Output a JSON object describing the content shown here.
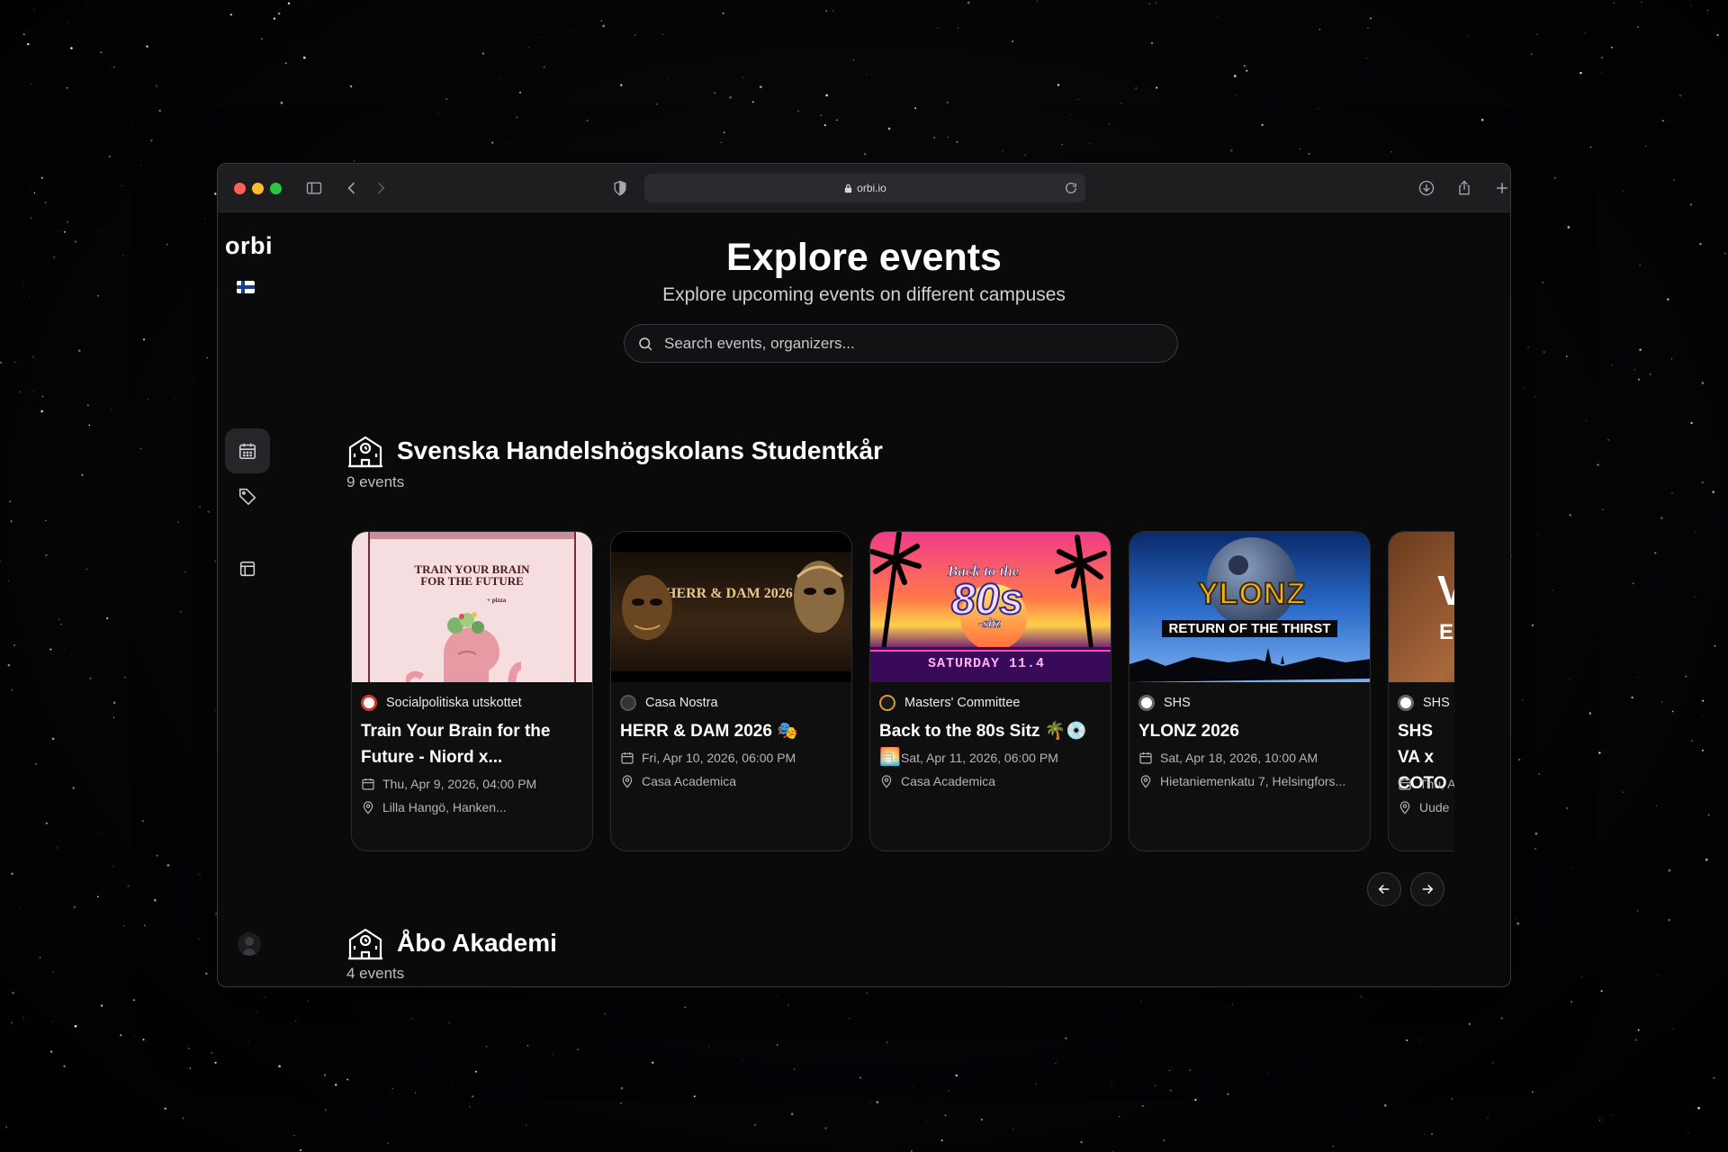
{
  "browser": {
    "url": "orbi.io"
  },
  "app": {
    "logo": "orbi"
  },
  "hero": {
    "title": "Explore events",
    "subtitle": "Explore upcoming events on different campuses"
  },
  "search": {
    "placeholder": "Search events, organizers..."
  },
  "sections": [
    {
      "title": "Svenska Handelshögskolans Studentkår",
      "count": "9 events",
      "events": [
        {
          "organizer": "Socialpolitiska utskottet",
          "title": "Train Your Brain for the Future - Niord x...",
          "date": "Thu, Apr 9, 2026, 04:00 PM",
          "location": "Lilla Hangö, Hanken...",
          "image_text": [
            "TRAIN YOUR BRAIN",
            "FOR THE FUTURE",
            "+ pizza"
          ]
        },
        {
          "organizer": "Casa Nostra",
          "title": "HERR & DAM 2026 🎭",
          "date": "Fri, Apr 10, 2026, 06:00 PM",
          "location": "Casa Academica",
          "image_text": [
            "HERR & DAM 2026"
          ]
        },
        {
          "organizer": "Masters' Committee",
          "title": "Back to the 80s Sitz 🌴💿🌅",
          "date": "Sat, Apr 11, 2026, 06:00 PM",
          "location": "Casa Academica",
          "image_text": [
            "Back to the",
            "80s",
            "-sitz",
            "SATURDAY 11.4"
          ]
        },
        {
          "organizer": "SHS",
          "title": "YLONZ 2026",
          "date": "Sat, Apr 18, 2026, 10:00 AM",
          "location": "Hietaniemenkatu 7, Helsingfors...",
          "image_text": [
            "YLONZ",
            "RETURN OF THE THIRST"
          ]
        },
        {
          "organizer": "SHS",
          "title": "SHS VA x COTO",
          "date": "Thu, A",
          "location": "Uude",
          "image_text": [
            "V",
            "E"
          ]
        }
      ]
    },
    {
      "title": "Åbo Akademi",
      "count": "4 events"
    }
  ]
}
